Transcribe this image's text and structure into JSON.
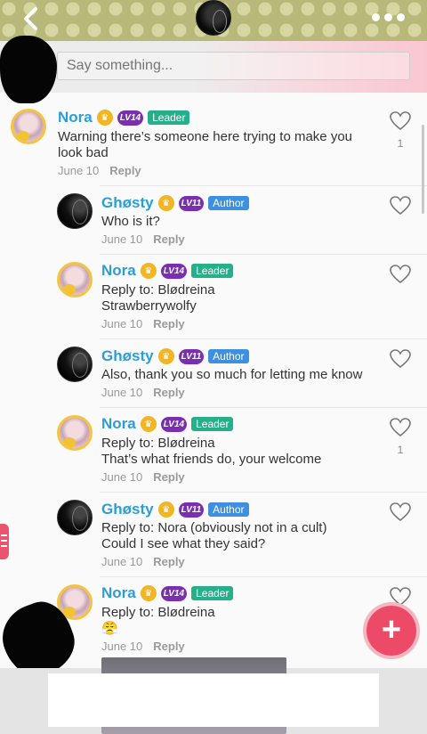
{
  "header": {
    "back_icon": "chevron-left-icon",
    "more_icon": "ellipsis-icon"
  },
  "composer": {
    "placeholder": "Say something..."
  },
  "comments": [
    {
      "author": "Nora",
      "level": "LV14",
      "role": "Leader",
      "lines": [
        "Warning there’s someone here trying to make you",
        "look bad"
      ],
      "date": "June 10",
      "reply_label": "Reply",
      "likes": "1"
    },
    {
      "author": "Ghøsty",
      "level": "LV11",
      "role": "Author",
      "lines": [
        "Who is it?"
      ],
      "date": "June 10",
      "reply_label": "Reply",
      "likes": ""
    },
    {
      "author": "Nora",
      "level": "LV14",
      "role": "Leader",
      "lines": [
        "Reply to: Blødreina",
        "Strawberrywolfy"
      ],
      "date": "June 10",
      "reply_label": "Reply",
      "likes": ""
    },
    {
      "author": "Ghøsty",
      "level": "LV11",
      "role": "Author",
      "lines": [
        "Also, thank you so much for letting me know"
      ],
      "date": "June 10",
      "reply_label": "Reply",
      "likes": ""
    },
    {
      "author": "Nora",
      "level": "LV14",
      "role": "Leader",
      "lines": [
        "Reply to: Blødreina",
        "That’s what friends do, your welcome"
      ],
      "date": "June 10",
      "reply_label": "Reply",
      "likes": "1"
    },
    {
      "author": "Ghøsty",
      "level": "LV11",
      "role": "Author",
      "lines": [
        "Reply to: Nora (obviously not in a cult)",
        "Could I see what they said?"
      ],
      "date": "June 10",
      "reply_label": "Reply",
      "likes": ""
    },
    {
      "author": "Nora",
      "level": "LV14",
      "role": "Leader",
      "lines": [
        "Reply to: Blødreina",
        "😤"
      ],
      "date": "June 10",
      "reply_label": "Reply",
      "likes": ""
    }
  ],
  "fab": {
    "label": "+",
    "icon": "plus-icon"
  },
  "colors": {
    "name": "#2e9dd6",
    "leader_badge": "#25b08a",
    "author_badge": "#3d8fe0",
    "level_badge": "#7a2fb0",
    "fab": "#ec4a66"
  }
}
